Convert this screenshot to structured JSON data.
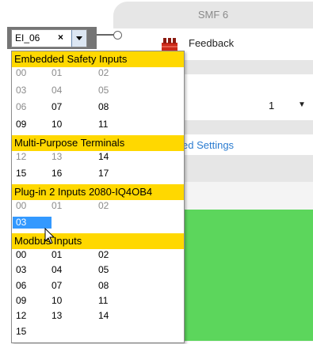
{
  "smf_panel": {
    "title": "SMF 6",
    "feedback_label": "Feedback",
    "value_text": "1",
    "link_text": "ed Settings",
    "colors": {
      "green_area": "#5cd65c"
    }
  },
  "combo": {
    "value": "EI_06",
    "clear_symbol": "×"
  },
  "dropdown": {
    "groups": [
      {
        "header": "Embedded Safety Inputs",
        "items": [
          {
            "label": "00",
            "state": "disabled"
          },
          {
            "label": "01",
            "state": "disabled"
          },
          {
            "label": "02",
            "state": "disabled"
          },
          {
            "label": "03",
            "state": "disabled"
          },
          {
            "label": "04",
            "state": "disabled"
          },
          {
            "label": "05",
            "state": "disabled"
          },
          {
            "label": "06",
            "state": "disabled"
          },
          {
            "label": "07",
            "state": "enabled"
          },
          {
            "label": "08",
            "state": "enabled"
          },
          {
            "label": "09",
            "state": "enabled"
          },
          {
            "label": "10",
            "state": "enabled"
          },
          {
            "label": "11",
            "state": "enabled"
          }
        ]
      },
      {
        "header": "Multi-Purpose Terminals",
        "items": [
          {
            "label": "12",
            "state": "disabled"
          },
          {
            "label": "13",
            "state": "disabled"
          },
          {
            "label": "14",
            "state": "enabled"
          },
          {
            "label": "15",
            "state": "enabled"
          },
          {
            "label": "16",
            "state": "enabled"
          },
          {
            "label": "17",
            "state": "enabled"
          }
        ]
      },
      {
        "header": "Plug-in 2 Inputs 2080-IQ4OB4",
        "items": [
          {
            "label": "00",
            "state": "disabled"
          },
          {
            "label": "01",
            "state": "disabled"
          },
          {
            "label": "02",
            "state": "disabled"
          },
          {
            "label": "03",
            "state": "selected"
          }
        ]
      },
      {
        "header": "Modbus Inputs",
        "items": [
          {
            "label": "00",
            "state": "enabled"
          },
          {
            "label": "01",
            "state": "enabled"
          },
          {
            "label": "02",
            "state": "enabled"
          },
          {
            "label": "03",
            "state": "enabled"
          },
          {
            "label": "04",
            "state": "enabled"
          },
          {
            "label": "05",
            "state": "enabled"
          },
          {
            "label": "06",
            "state": "enabled"
          },
          {
            "label": "07",
            "state": "enabled"
          },
          {
            "label": "08",
            "state": "enabled"
          },
          {
            "label": "09",
            "state": "enabled"
          },
          {
            "label": "10",
            "state": "enabled"
          },
          {
            "label": "11",
            "state": "enabled"
          },
          {
            "label": "12",
            "state": "enabled"
          },
          {
            "label": "13",
            "state": "enabled"
          },
          {
            "label": "14",
            "state": "enabled"
          },
          {
            "label": "15",
            "state": "enabled"
          }
        ]
      }
    ]
  },
  "colors": {
    "group_header": "#ffd800",
    "selection": "#3399ff",
    "disabled_text": "#8c8c8c"
  }
}
